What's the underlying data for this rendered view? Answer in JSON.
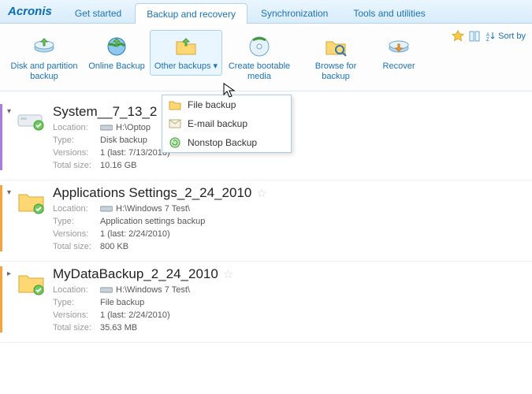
{
  "brand": "Acronis",
  "header": {
    "tabs": [
      {
        "label": "Get started",
        "active": false
      },
      {
        "label": "Backup and recovery",
        "active": true
      },
      {
        "label": "Synchronization",
        "active": false
      },
      {
        "label": "Tools and utilities",
        "active": false
      }
    ]
  },
  "ribbon": {
    "disk_partition": "Disk and partition backup",
    "online_backup": "Online Backup",
    "other_backups": "Other backups",
    "create_media": "Create bootable media",
    "browse": "Browse for backup",
    "recover": "Recover",
    "sort_by": "Sort by"
  },
  "menu": {
    "file_backup": "File backup",
    "email_backup": "E-mail backup",
    "nonstop_backup": "Nonstop Backup"
  },
  "labels": {
    "location": "Location:",
    "type": "Type:",
    "versions": "Versions:",
    "total_size": "Total size:"
  },
  "entries": [
    {
      "stripe": "purple",
      "icon": "disk",
      "title": "System__7_13_2",
      "location": "H:\\Optop",
      "type": "Disk backup",
      "versions": "1  (last: 7/13/2010)",
      "total_size": "10.16 GB"
    },
    {
      "stripe": "orange",
      "icon": "folder",
      "title": "Applications Settings_2_24_2010",
      "location": "H:\\Windows 7 Test\\",
      "type": "Application settings backup",
      "versions": "1  (last: 2/24/2010)",
      "total_size": "800 KB"
    },
    {
      "stripe": "orange",
      "icon": "folder",
      "title": "MyDataBackup_2_24_2010",
      "location": "H:\\Windows 7 Test\\",
      "type": "File backup",
      "versions": "1  (last: 2/24/2010)",
      "total_size": "35.63 MB"
    }
  ]
}
